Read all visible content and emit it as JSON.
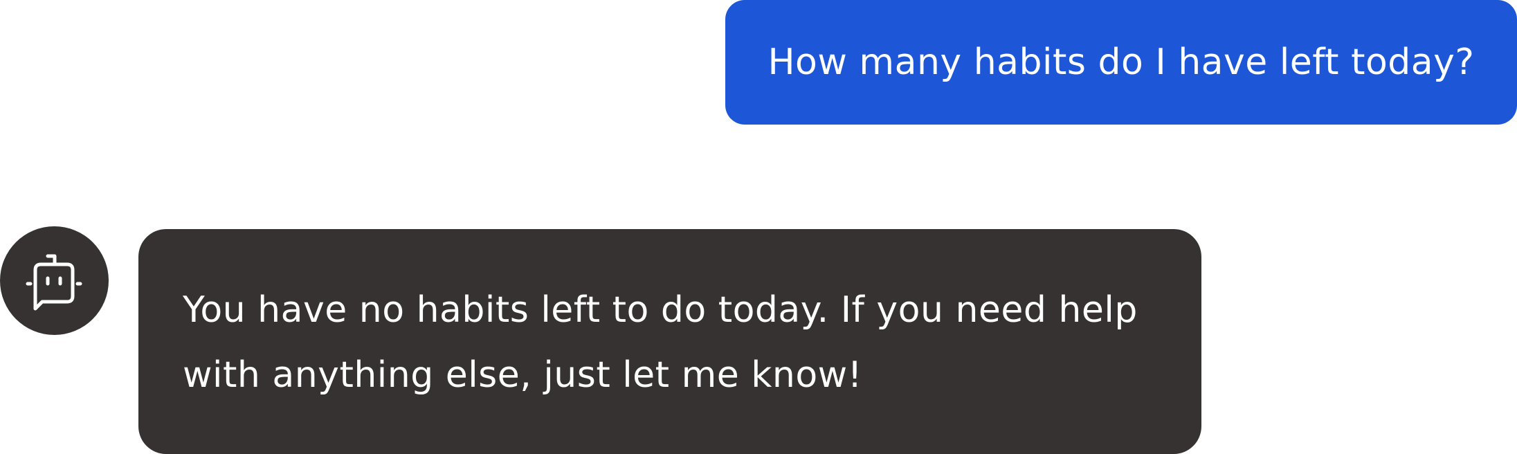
{
  "chat": {
    "messages": [
      {
        "role": "user",
        "text": "How many habits do I have left today?"
      },
      {
        "role": "assistant",
        "avatar_icon": "robot-chat-icon",
        "text": "You have no habits left to do today. If you need help with anything else, just let me know!"
      }
    ]
  },
  "colors": {
    "user_bubble": "#1d57d8",
    "assistant_bubble": "#363231",
    "text": "#ffffff",
    "background": "#ffffff"
  }
}
